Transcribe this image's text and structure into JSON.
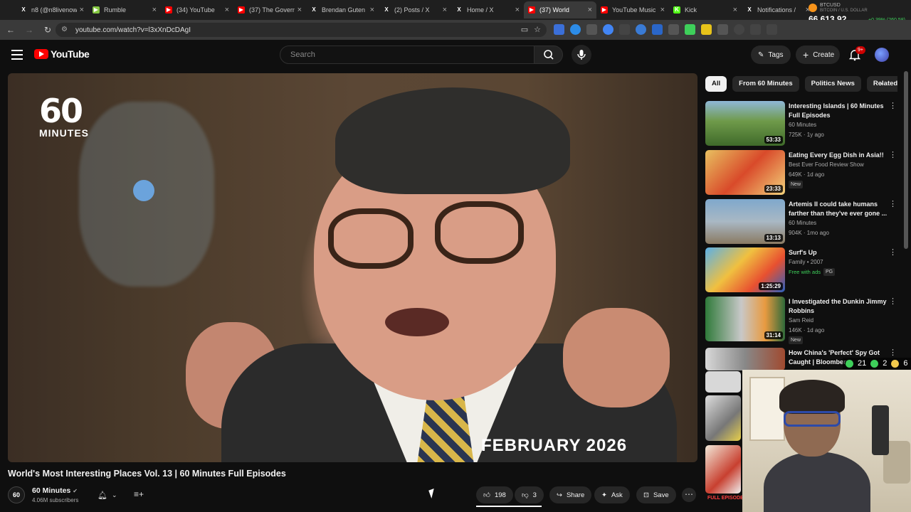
{
  "browser": {
    "tabs": [
      {
        "title": "n8 (@n8livenow",
        "fav_color": "#ffffff",
        "fav_char": "X"
      },
      {
        "title": "Rumble",
        "fav_color": "#85c742",
        "fav_char": "▶"
      },
      {
        "title": "(34) YouTube",
        "fav_color": "#ff0000",
        "fav_char": "▶"
      },
      {
        "title": "(37) The Govern",
        "fav_color": "#ff0000",
        "fav_char": "▶"
      },
      {
        "title": "Brendan Guten",
        "fav_color": "#ffffff",
        "fav_char": "X"
      },
      {
        "title": "(2) Posts / X",
        "fav_color": "#ffffff",
        "fav_char": "X"
      },
      {
        "title": "Home / X",
        "fav_color": "#ffffff",
        "fav_char": "X"
      },
      {
        "title": "(37) World",
        "fav_color": "#ff0000",
        "fav_char": "▶"
      },
      {
        "title": "YouTube Music",
        "fav_color": "#ff0000",
        "fav_char": "▶"
      },
      {
        "title": "Kick",
        "fav_color": "#53fc18",
        "fav_char": "K"
      },
      {
        "title": "Notifications /",
        "fav_color": "#ffffff",
        "fav_char": "X"
      }
    ],
    "active_tab_index": 7,
    "url": "youtube.com/watch?v=l3xXnDcDAgI",
    "ticker": {
      "symbol": "BTCUSD",
      "subtitle": "BITCOIN / U.S. DOLLAR",
      "price": "66,613.92",
      "change": "+0.39% (260.58)"
    }
  },
  "header": {
    "logo_text": "YouTube",
    "search_placeholder": "Search",
    "tags_label": "Tags",
    "create_label": "Create",
    "notif_badge": "9+"
  },
  "player": {
    "brand_number": "60",
    "brand_word": "MINUTES",
    "date_overlay": "FEBRUARY 2026"
  },
  "video": {
    "title": "World's Most Interesting Places Vol. 13 | 60 Minutes Full Episodes",
    "channel": "60 Minutes",
    "channel_avatar": "60",
    "subscribers": "4.06M subscribers",
    "likes": "198",
    "dislikes": "3",
    "share_label": "Share",
    "ask_label": "Ask",
    "save_label": "Save"
  },
  "chips": [
    "All",
    "From 60 Minutes",
    "Politics News",
    "Related"
  ],
  "recommendations": [
    {
      "title": "Interesting Islands | 60 Minutes Full Episodes",
      "channel": "60 Minutes",
      "stats": "725K · 1y ago",
      "duration": "53:33"
    },
    {
      "title": "Eating Every Egg Dish in Asia!!",
      "channel": "Best Ever Food Review Show",
      "stats": "649K · 1d ago",
      "duration": "23:33",
      "badge": "New"
    },
    {
      "title": "Artemis II could take humans farther than they've ever gone ...",
      "channel": "60 Minutes",
      "stats": "904K · 1mo ago",
      "duration": "13:13"
    },
    {
      "title": "Surf's Up",
      "channel": "Family • 2007",
      "stats": "",
      "duration": "1:25:29",
      "ads": "Free with ads",
      "rating": "PG"
    },
    {
      "title": "I Investigated the Dunkin Jimmy Robbins",
      "channel": "Sam Reid",
      "stats": "146K · 1d ago",
      "duration": "31:14",
      "badge": "New"
    },
    {
      "title": "How China's 'Perfect' Spy Got Caught | Bloomberg",
      "channel": "",
      "stats": "",
      "duration": ""
    }
  ],
  "partial_thumb_text": "FULL EPISODE",
  "stream_counts": {
    "a": "21",
    "b": "2",
    "c": "6"
  },
  "colors": {
    "bg": "#0f0f0f",
    "accent": "#ff0000",
    "chip": "#272727",
    "green": "#3ecf5a"
  }
}
